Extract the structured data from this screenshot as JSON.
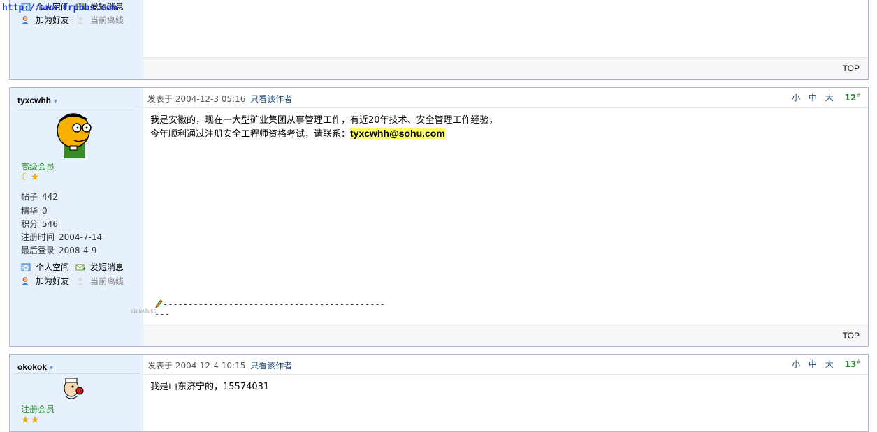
{
  "watermark": "http://www.frpbbs.com",
  "common": {
    "posted_prefix": "发表于",
    "only_author": "只看该作者",
    "size_small": "小",
    "size_medium": "中",
    "size_large": "大",
    "top": "TOP",
    "personal_space": "个人空间",
    "send_message": "发短消息",
    "add_friend": "加为好友",
    "offline": "当前离线",
    "label_posts": "帖子",
    "label_digest": "精华",
    "label_points": "积分",
    "label_reg": "注册时间",
    "label_last": "最后登录",
    "floor_mark": "#"
  },
  "post0": {},
  "post1": {
    "username": "tyxcwhh",
    "posted_at": "2004-12-3 05:16",
    "floor": "12",
    "rank": "高级会员",
    "posts": "442",
    "digest": "0",
    "points": "546",
    "reg_date": "2004-7-14",
    "last_login": "2008-4-9",
    "line1": "我是安徽的，现在一大型矿业集团从事管理工作，有近20年技术、安全管理工作经验，",
    "line2": "今年顺利通过注册安全工程师资格考试，请联系：",
    "email": "tyxcwhh@sohu.com",
    "signature": "-----------------------------------------------",
    "signature_tag": "SIGNATURE"
  },
  "post2": {
    "username": "okokok",
    "posted_at": "2004-12-4 10:15",
    "floor": "13",
    "rank": "注册会员",
    "line1": "我是山东济宁的，15574031"
  },
  "colors": {
    "sidebar_bg": "#e7f1fd",
    "rank": "#2a8a2a",
    "link": "#1b4c80",
    "highlight": "#ffff66"
  }
}
